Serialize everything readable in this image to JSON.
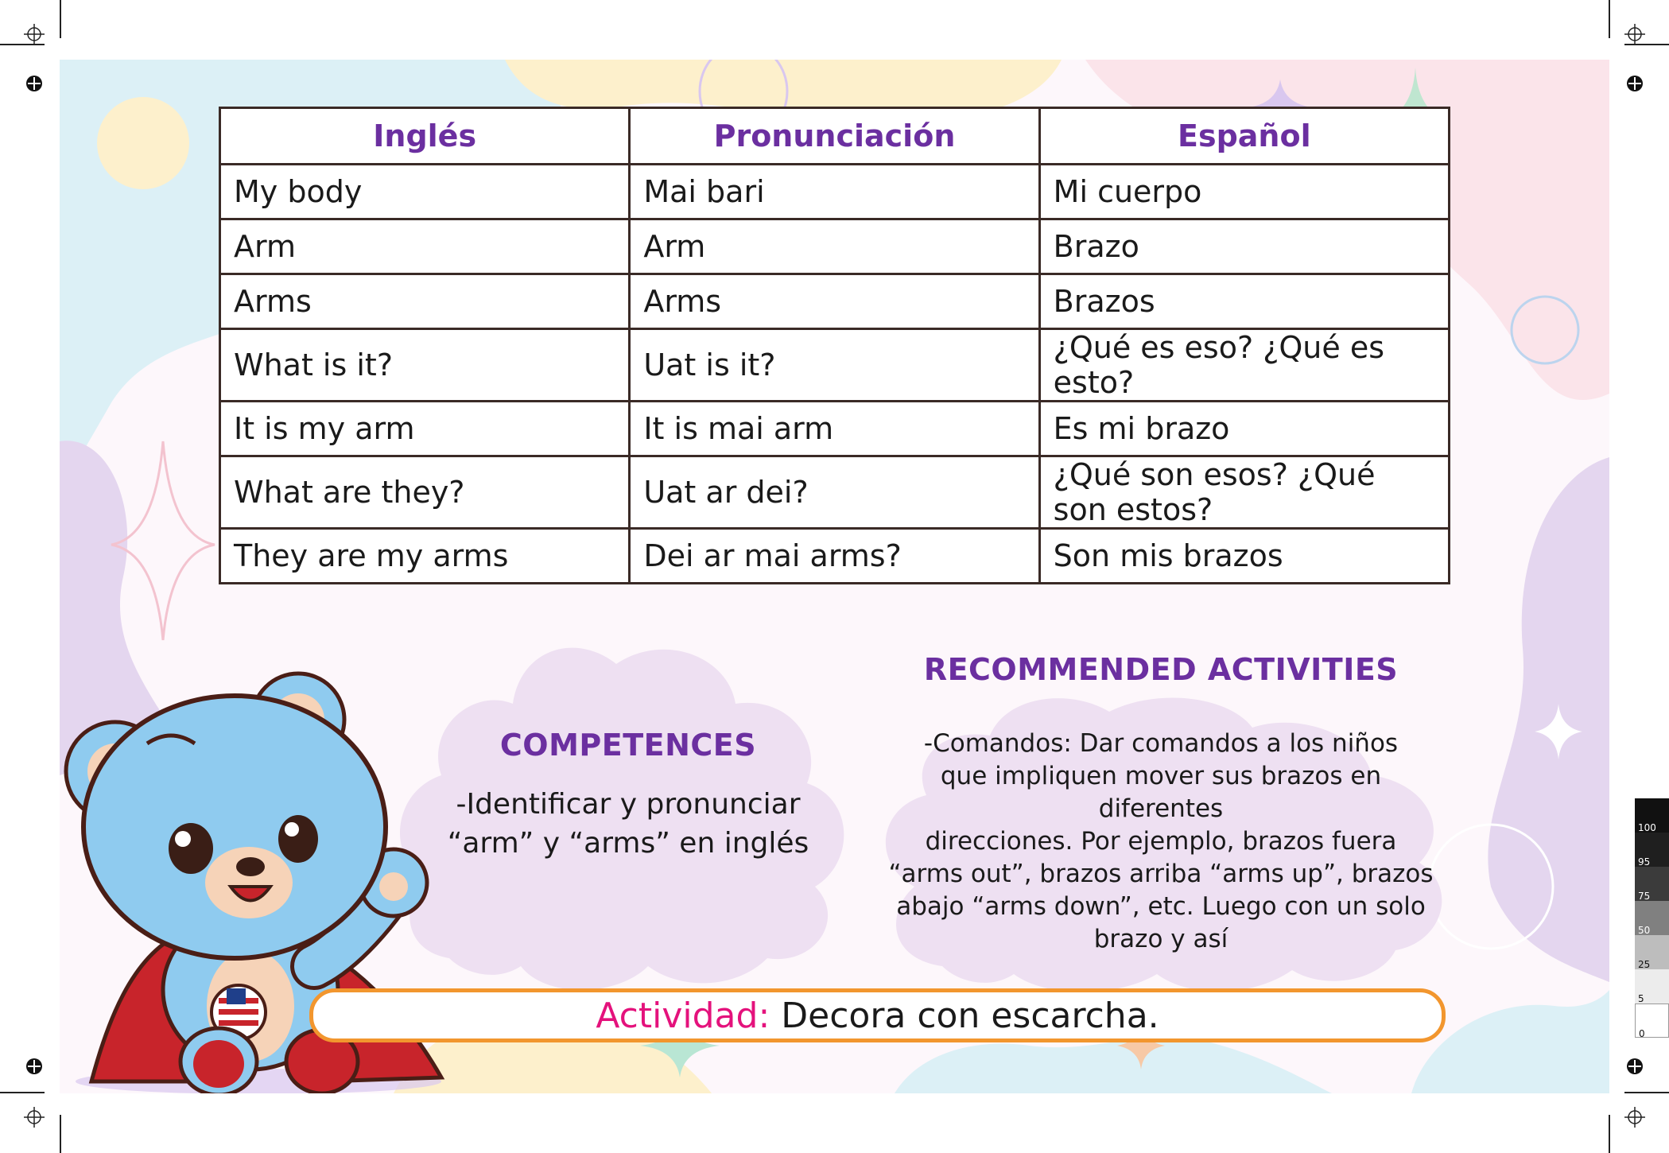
{
  "table": {
    "headers": [
      "Inglés",
      "Pronunciación",
      "Español"
    ],
    "rows": [
      [
        "My body",
        "Mai bari",
        "Mi cuerpo"
      ],
      [
        "Arm",
        "Arm",
        "Brazo"
      ],
      [
        "Arms",
        "Arms",
        "Brazos"
      ],
      [
        "What is it?",
        "Uat is it?",
        "¿Qué es eso? ¿Qué es esto?"
      ],
      [
        "It is my arm",
        "It is mai arm",
        "Es mi brazo"
      ],
      [
        "What are they?",
        "Uat ar dei?",
        "¿Qué son esos? ¿Qué son estos?"
      ],
      [
        "They are my arms",
        "Dei ar mai arms?",
        "Son mis brazos"
      ]
    ]
  },
  "competences": {
    "title": "COMPETENCES",
    "text": "-Identificar y pronunciar\n“arm” y “arms” en inglés"
  },
  "recommended": {
    "title": "RECOMMENDED ACTIVITIES",
    "text": "-Comandos: Dar comandos a los niños\nque impliquen mover sus brazos en diferentes\ndirecciones. Por ejemplo, brazos fuera\n“arms out”, brazos arriba “arms up”, brazos\nabajo “arms down”, etc. Luego con un solo\nbrazo y así"
  },
  "activity": {
    "label": "Actividad:",
    "text": " Decora con escarcha."
  },
  "colorbar": [
    "100",
    "95",
    "75",
    "50",
    "25",
    "5",
    "0"
  ],
  "colors": {
    "header_text": "#6b2fa0",
    "activity_label": "#e4127c",
    "activity_border": "#f2962e",
    "cloud": "#eee0f2",
    "bear": "#8fcbef",
    "cape": "#c8242b"
  }
}
